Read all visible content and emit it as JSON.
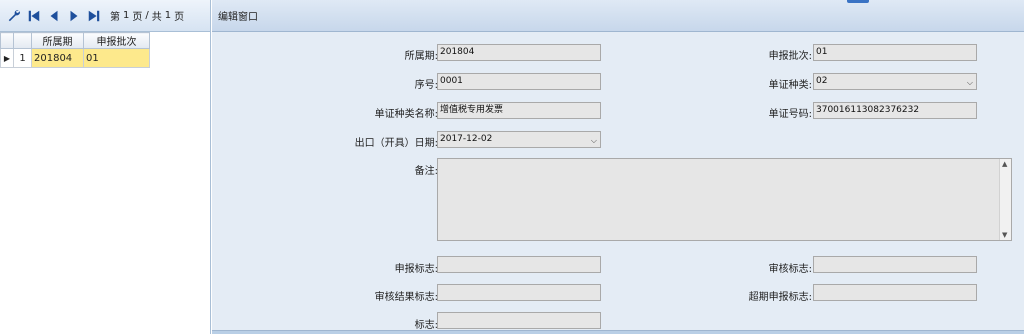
{
  "toolbar": {
    "page_prefix": "第",
    "page_current": "1",
    "page_unit": "页",
    "separator": "/",
    "page_total_prefix": "共",
    "page_total": "1",
    "page_total_unit": "页"
  },
  "grid": {
    "columns": [
      "所属期",
      "申报批次"
    ],
    "rows": [
      {
        "row_no": "1",
        "period": "201804",
        "batch": "01",
        "selected": true
      }
    ]
  },
  "editor": {
    "title": "编辑窗口",
    "labels": {
      "period": "所属期:",
      "batch": "申报批次:",
      "seq": "序号:",
      "voucher_type": "单证种类:",
      "voucher_type_name": "单证种类名称:",
      "voucher_no": "单证号码:",
      "export_date": "出口（开具）日期:",
      "remark": "备注:",
      "declare_flag": "申报标志:",
      "audit_flag": "审核标志:",
      "audit_result_flag": "审核结果标志:",
      "overdue_flag": "超期申报标志:",
      "flag": "标志:"
    },
    "values": {
      "period": "201804",
      "batch": "01",
      "seq": "0001",
      "voucher_type": "02",
      "voucher_type_name": "增值税专用发票",
      "voucher_no": "370016113082376232",
      "export_date": "2017-12-02",
      "remark": "",
      "declare_flag": "",
      "audit_flag": "",
      "audit_result_flag": "",
      "overdue_flag": "",
      "flag": ""
    }
  },
  "colors": {
    "selected_row": "#fde98c",
    "panel_bg": "#e4ecf5",
    "field_bg": "#e6e6e6",
    "icon_blue": "#1e4f9c"
  }
}
